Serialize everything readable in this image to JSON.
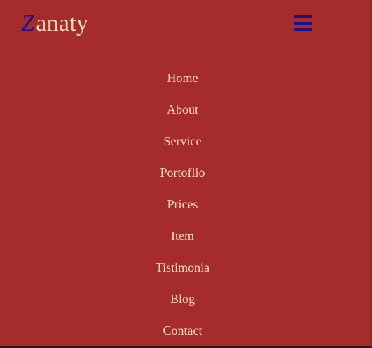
{
  "brand": {
    "initial": "Z",
    "rest": "anaty"
  },
  "menu_toggle": {
    "icon": "hamburger-menu-icon"
  },
  "nav": {
    "items": [
      {
        "label": "Home"
      },
      {
        "label": "About"
      },
      {
        "label": "Service"
      },
      {
        "label": "Portoflio"
      },
      {
        "label": "Prices"
      },
      {
        "label": "Item"
      },
      {
        "label": "Tistimonia"
      },
      {
        "label": "Blog"
      },
      {
        "label": "Contact"
      }
    ]
  },
  "colors": {
    "background": "#a62b2b",
    "text": "#f2d7bf",
    "accent": "#1f0f8a"
  }
}
